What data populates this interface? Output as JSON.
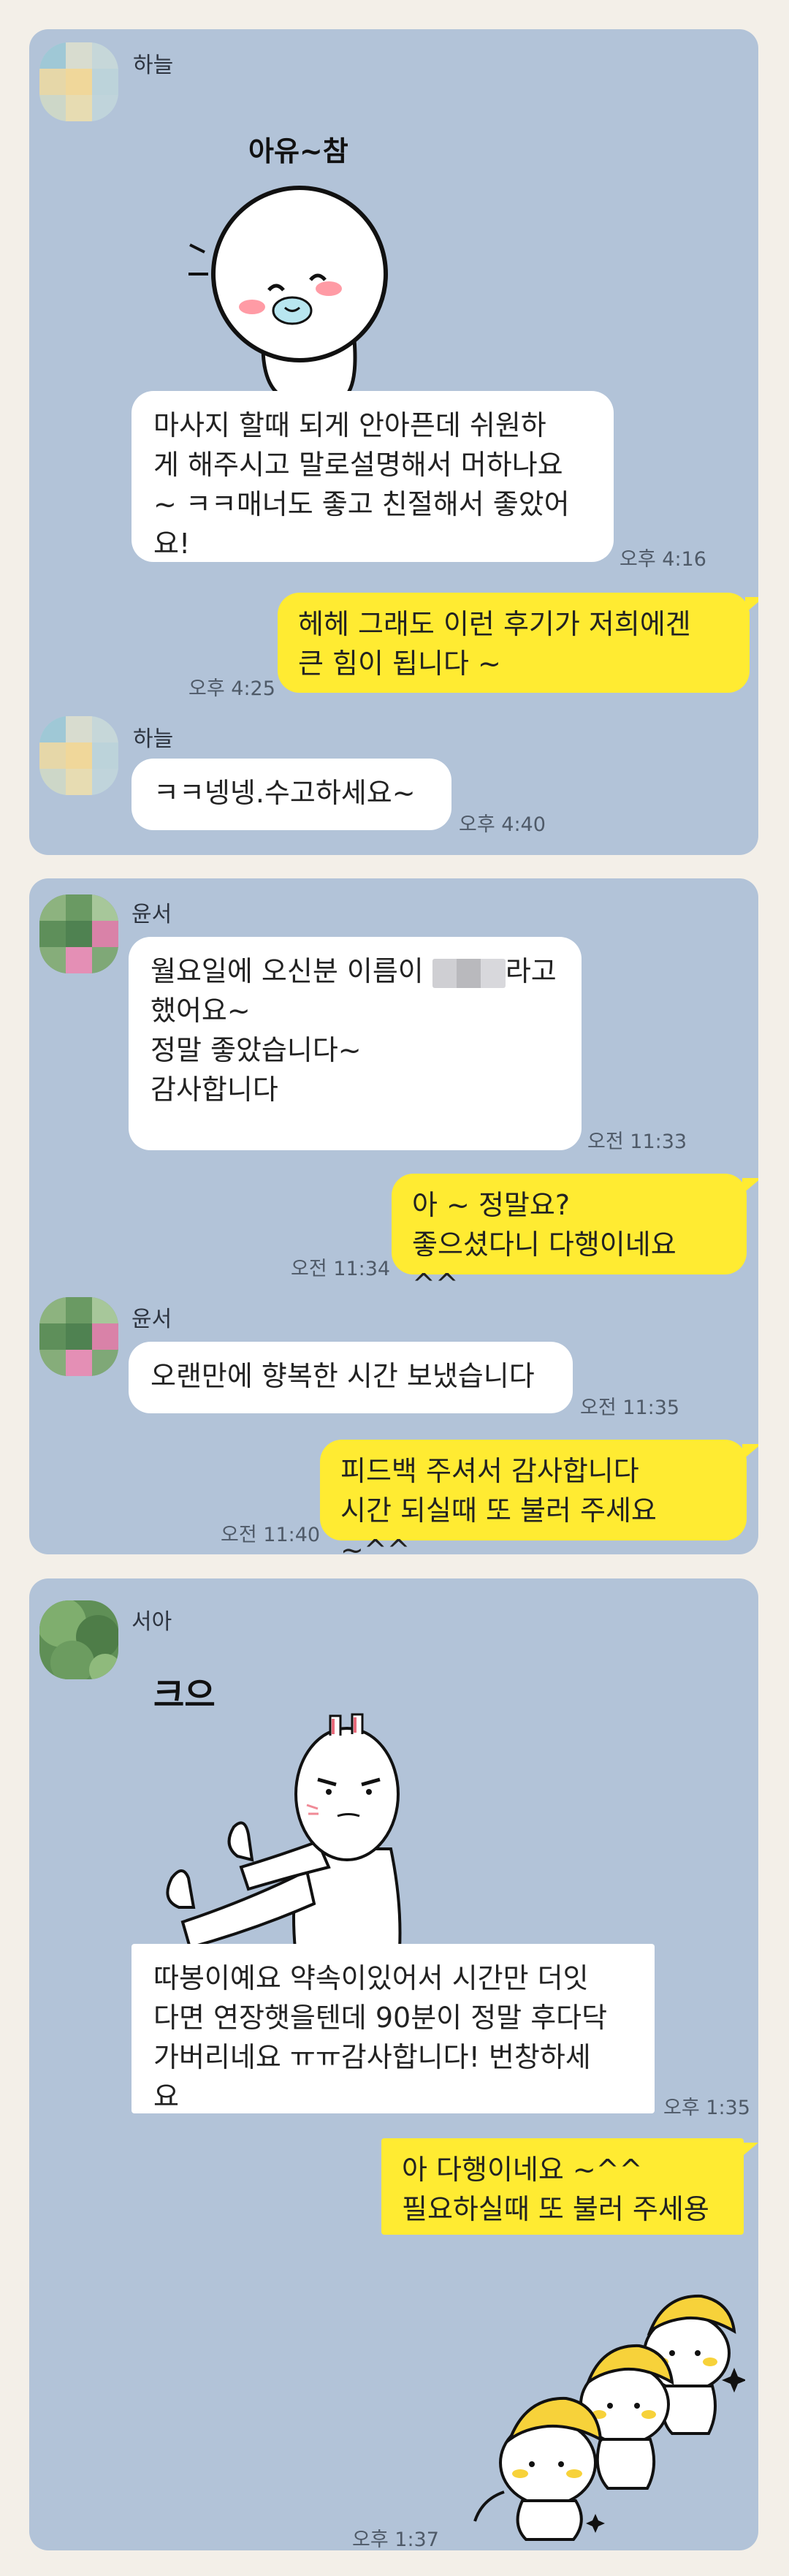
{
  "card1": {
    "sender1": "하늘",
    "sticker_text": "아유~참",
    "msg1": "마사지 할때 되게 안아픈데 쉬원하\n게 해주시고 말로설명해서 머하나요\n~ ㅋㅋ매너도 좋고 친절해서 좋았어\n요!",
    "time1": "오후 4:16",
    "reply1": "헤헤 그래도 이런 후기가 저희에겐\n큰 힘이 됩니다 ~",
    "reply_time1": "오후 4:25",
    "sender2": "하늘",
    "msg2": "ㅋㅋ넹넹.수고하세요~",
    "time2": "오후 4:40"
  },
  "card2": {
    "sender1": "윤서",
    "msg1_a": "월요일에 오신분 이름이 ",
    "msg1_b": "라고\n했어요~\n정말 좋았습니다~\n감사합니다",
    "time1": "오전 11:33",
    "reply1": "아 ~ 정말요?\n좋으셨다니 다행이네요 ^^",
    "reply_time1": "오전 11:34",
    "sender2": "윤서",
    "msg2": "오랜만에 향복한 시간 보냈습니다",
    "time2": "오전 11:35",
    "reply2": "피드백 주셔서 감사합니다\n시간 되실때 또 불러 주세요 ~^^",
    "reply_time2": "오전 11:40"
  },
  "card3": {
    "sender1": "서아",
    "sticker_text": "크으",
    "msg1": "따봉이예요 약속이있어서 시간만 더잇\n다면 연장햇을텐데 90분이 정말 후다닥\n가버리네요 ㅠㅠ감사합니다! 번창하세\n요",
    "time1": "오후 1:35",
    "reply1": "아 다행이네요 ~^^\n필요하실때 또 불러 주세용",
    "reply_time1": "오후 1:37"
  },
  "colors": {
    "chat_bg": "#b2c3d8",
    "page_bg": "#f3efe8",
    "my_bubble": "#ffeb32",
    "their_bubble": "#ffffff"
  },
  "icons": {
    "avatars": "blurred-profile-avatar",
    "stickers": [
      "white-blob-sticker",
      "thumbs-up-rabbit-sticker",
      "banana-rabbits-sticker"
    ]
  }
}
